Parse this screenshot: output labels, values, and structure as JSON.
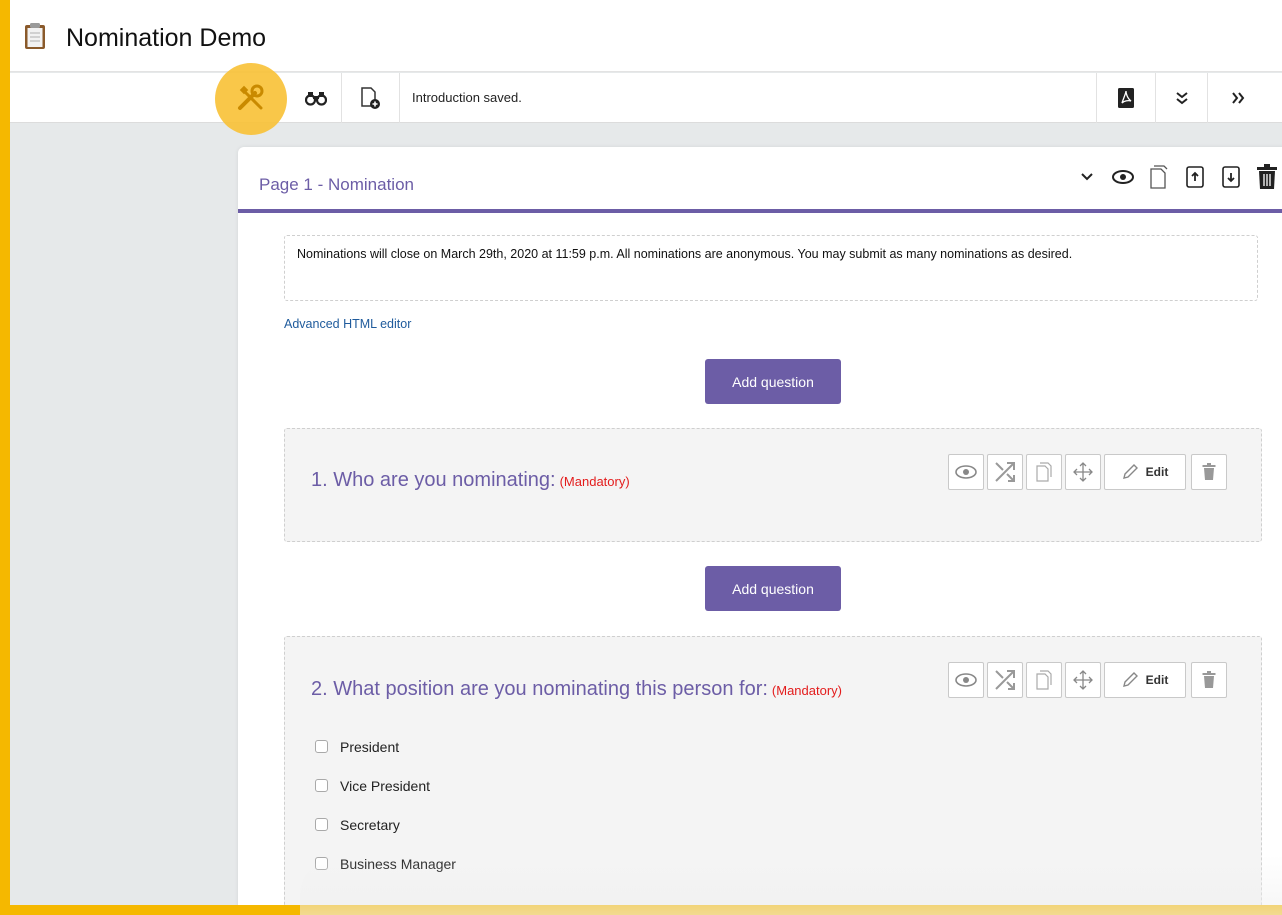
{
  "app": {
    "title": "Nomination Demo"
  },
  "toolbar": {
    "status_message": "Introduction saved.",
    "buttons": {
      "tools": "wrench-screwdriver-icon",
      "search": "binoculars-icon",
      "new_page": "add-page-icon",
      "pdf": "pdf-icon",
      "collapse": "chevron-double-down-icon",
      "expand": "chevron-double-right-icon"
    }
  },
  "page": {
    "title": "Page 1 - Nomination",
    "introduction": "Nominations will close on March 29th, 2020 at 11:59 p.m. All nominations are anonymous. You may submit as many nominations as desired.",
    "advanced_editor_link": "Advanced HTML editor",
    "add_question_label": "Add question",
    "questions": [
      {
        "number_title": "1. Who are you nominating:",
        "mandatory_label": "(Mandatory)",
        "edit_label": "Edit"
      },
      {
        "number_title": "2. What position are you nominating this person for:",
        "mandatory_label": "(Mandatory)",
        "edit_label": "Edit",
        "options": [
          "President",
          "Vice President",
          "Secretary",
          "Business Manager"
        ]
      }
    ]
  },
  "colors": {
    "accent": "#6c5da6",
    "mandatory": "#e31c1c",
    "link": "#1f5b9c",
    "highlight": "#f8c135",
    "frame": "#f5b800"
  }
}
